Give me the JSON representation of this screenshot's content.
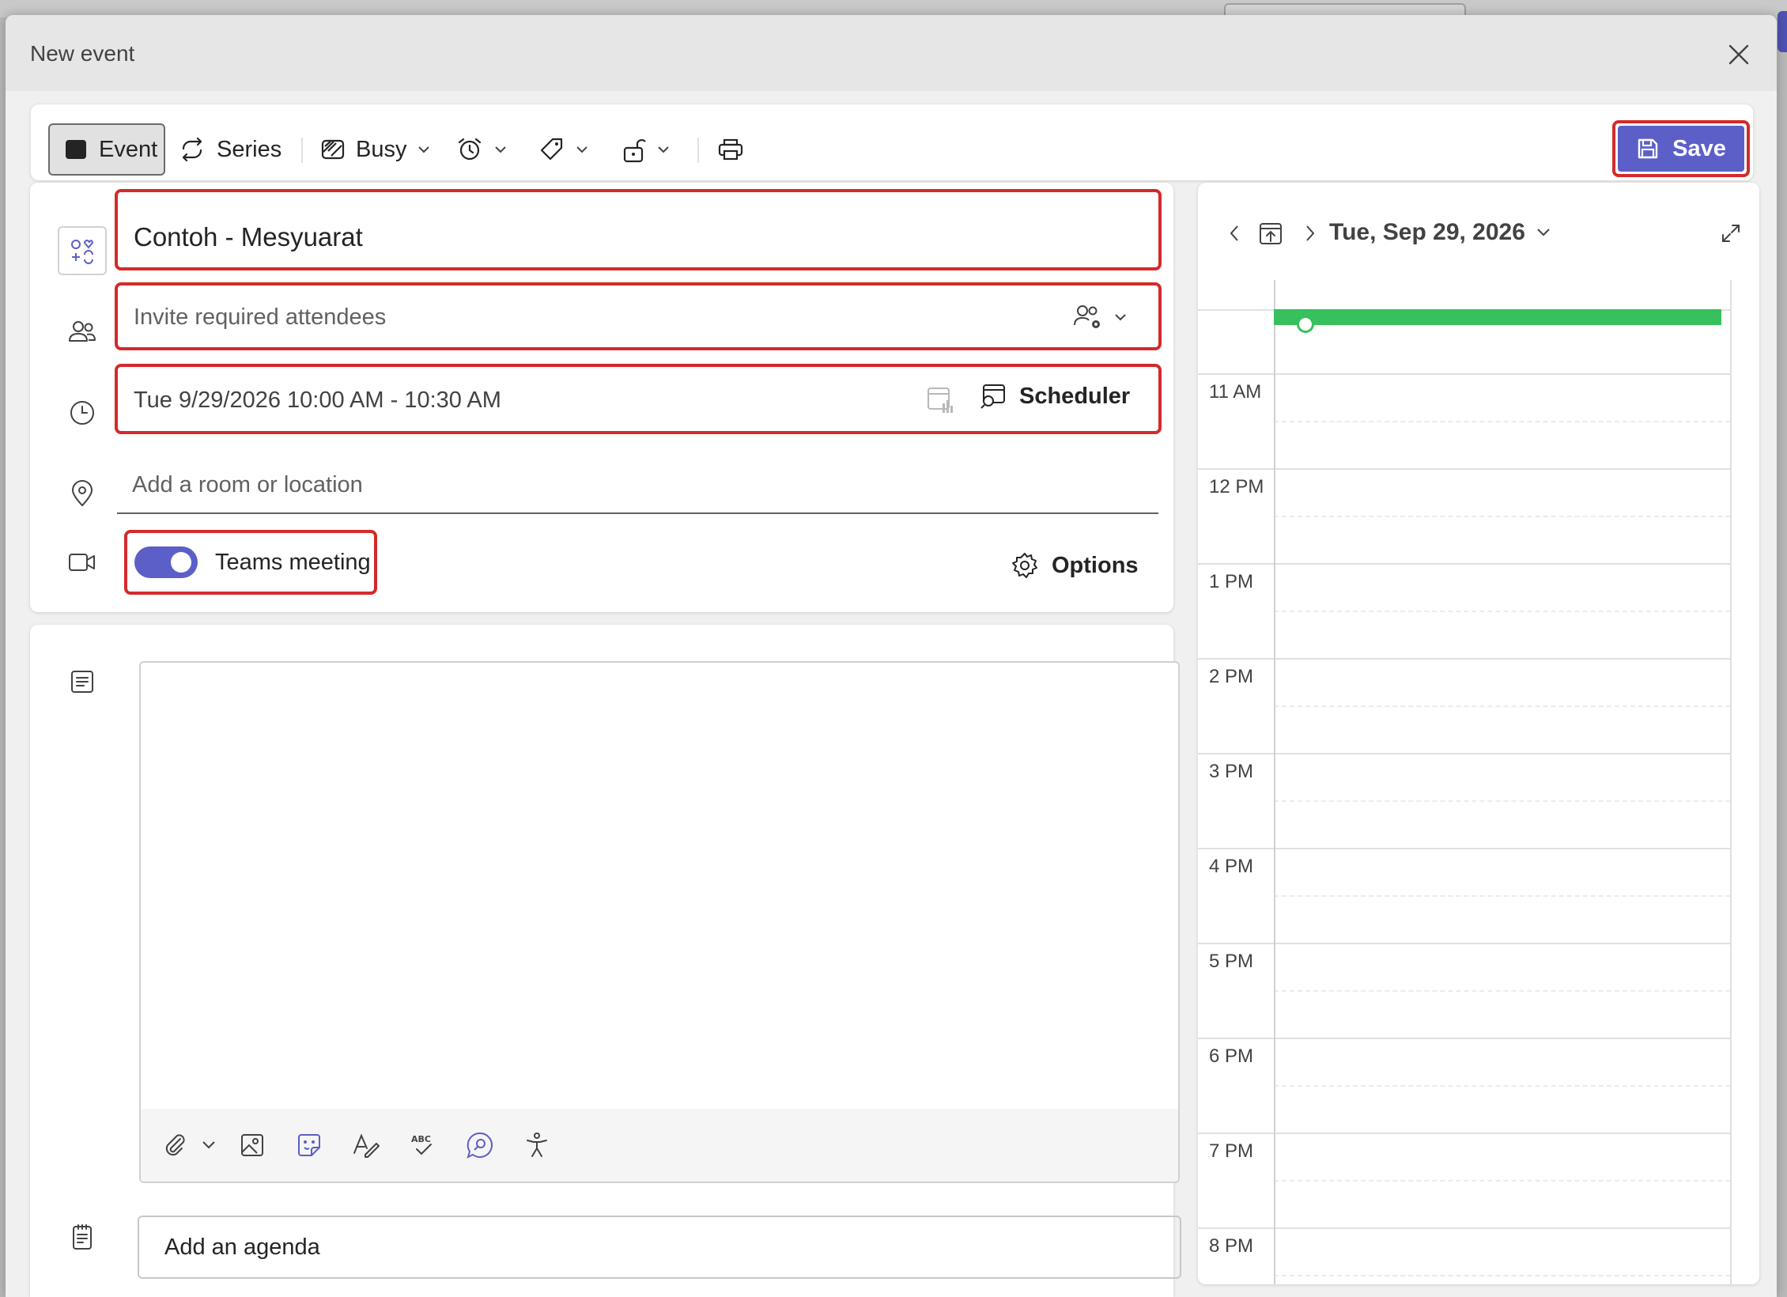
{
  "dialog": {
    "title": "New event"
  },
  "toolbar": {
    "event_label": "Event",
    "series_label": "Series",
    "busy_label": "Busy",
    "save_label": "Save"
  },
  "form": {
    "title_value": "Contoh - Mesyuarat",
    "attendees_placeholder": "Invite required attendees",
    "datetime_value": "Tue 9/29/2026 10:00 AM - 10:30 AM",
    "scheduler_label": "Scheduler",
    "location_placeholder": "Add a room or location",
    "teams_meeting_label": "Teams meeting",
    "teams_meeting_enabled": true,
    "options_label": "Options",
    "agenda_placeholder": "Add an agenda"
  },
  "calendar": {
    "date_label": "Tue, Sep 29, 2026",
    "hours": [
      "11 AM",
      "12 PM",
      "1 PM",
      "2 PM",
      "3 PM",
      "4 PM",
      "5 PM",
      "6 PM",
      "7 PM",
      "8 PM"
    ],
    "event_color": "#37c05c"
  },
  "colors": {
    "accent": "#5b5fc7",
    "highlight": "#d42a2a"
  }
}
